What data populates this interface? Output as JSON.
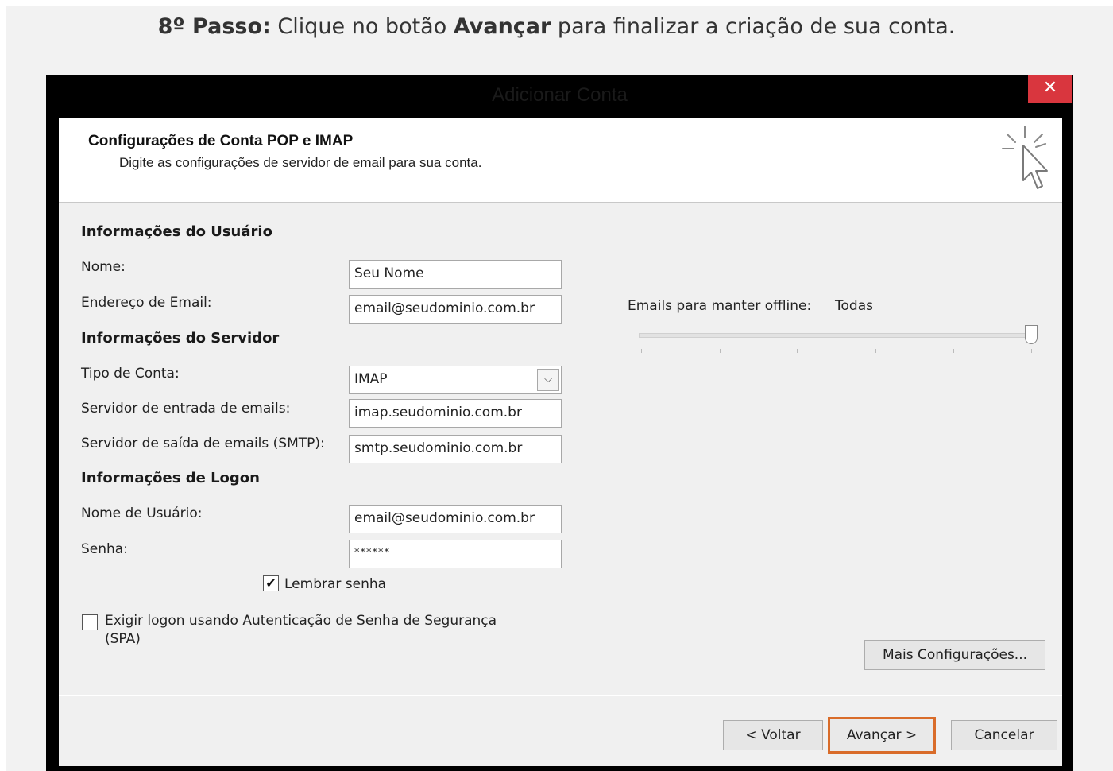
{
  "instruction": {
    "step": "8º Passo:",
    "text_before": " Clique no botão ",
    "button_name": "Avançar",
    "text_after": " para finalizar a criação de sua conta."
  },
  "window": {
    "title": "Adicionar Conta",
    "close_glyph": "✕"
  },
  "header": {
    "title": "Configurações de Conta POP e IMAP",
    "subtitle": "Digite as configurações de servidor de email para sua conta."
  },
  "user_info": {
    "section": "Informações do Usuário",
    "name_label": "Nome:",
    "name_value": "Seu Nome",
    "email_label": "Endereço de Email:",
    "email_value": "email@seudominio.com.br"
  },
  "server_info": {
    "section": "Informações do Servidor",
    "account_type_label": "Tipo de Conta:",
    "account_type_value": "IMAP",
    "incoming_label": "Servidor de entrada de emails:",
    "incoming_value": "imap.seudominio.com.br",
    "outgoing_label": "Servidor de saída de emails (SMTP):",
    "outgoing_value": "smtp.seudominio.com.br"
  },
  "logon_info": {
    "section": "Informações de Logon",
    "username_label": "Nome de Usuário:",
    "username_value": "email@seudominio.com.br",
    "password_label": "Senha:",
    "password_value": "******",
    "remember_label": "Lembrar senha",
    "remember_checked": true,
    "spa_label_line1": "Exigir logon usando Autenticação de Senha de Segurança",
    "spa_label_line2": "(SPA)",
    "spa_checked": false
  },
  "offline": {
    "label": "Emails para manter offline:",
    "value": "Todas",
    "slider_level": 1.0
  },
  "buttons": {
    "more_settings": "Mais Configurações...",
    "back": "< Voltar",
    "next": "Avançar >",
    "cancel": "Cancelar"
  },
  "icons": {
    "close": "close-icon",
    "cursor": "pointer-cursor-icon",
    "dropdown": "chevron-down-icon",
    "checkmark": "check-icon"
  },
  "colors": {
    "close_button": "#d9363e",
    "primary_highlight": "#d96c2a",
    "title_bar": "#000000",
    "dialog_bg": "#f0f0f0"
  }
}
